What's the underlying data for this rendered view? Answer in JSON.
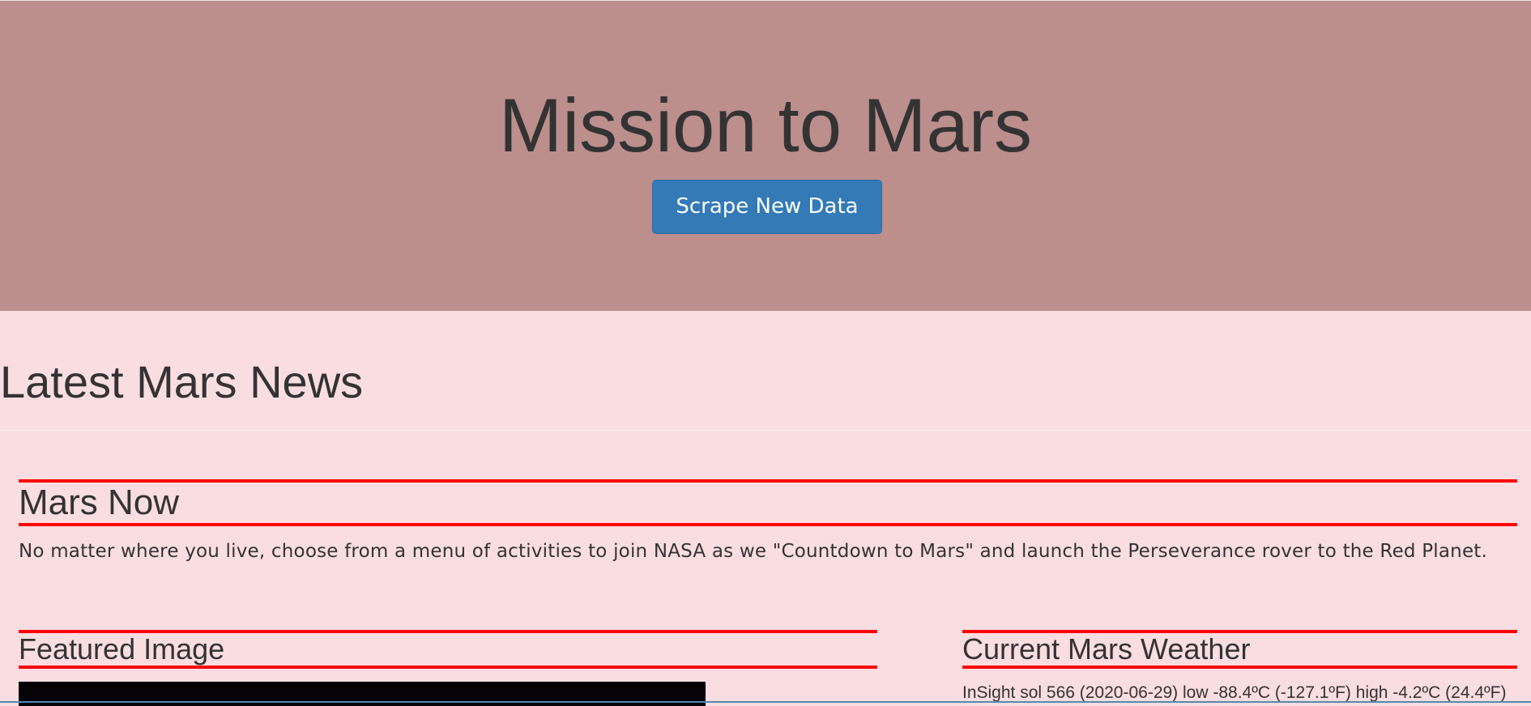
{
  "header": {
    "title": "Mission to Mars",
    "scrape_button_label": "Scrape New Data"
  },
  "news": {
    "section_heading": "Latest Mars News",
    "title": "Mars Now",
    "paragraph": "No matter where you live, choose from a menu of activities to join NASA as we \"Countdown to Mars\" and launch the Perseverance rover to the Red Planet."
  },
  "featured_image": {
    "heading": "Featured Image"
  },
  "weather": {
    "heading": "Current Mars Weather",
    "text": "InSight sol 566 (2020-06-29) low -88.4ºC (-127.1ºF) high -4.2ºC (24.4ºF)"
  },
  "colors": {
    "header_bg": "#bc8e8c",
    "page_bg": "#fadde1",
    "accent_line": "#ff0000",
    "button_bg": "#337ab7"
  }
}
